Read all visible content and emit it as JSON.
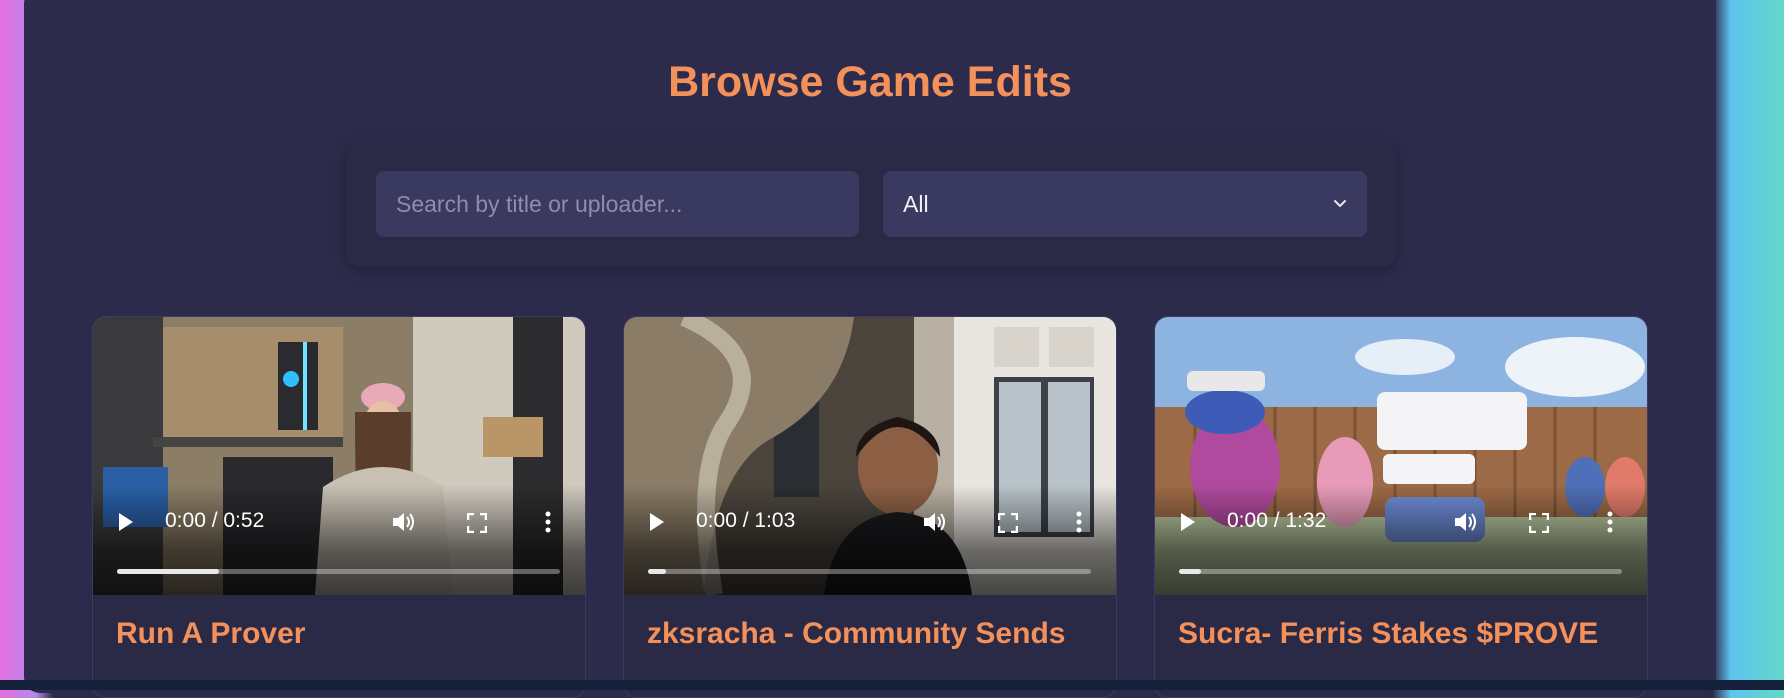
{
  "page": {
    "title": "Browse Game Edits"
  },
  "filters": {
    "search_placeholder": "Search by title or uploader...",
    "search_value": "",
    "category_selected": "All"
  },
  "videos": [
    {
      "title": "Run A Prover",
      "current_time": "0:00",
      "duration": "0:52",
      "time_display": "0:00 / 0:52",
      "progress": 0.23
    },
    {
      "title": "zksracha - Community Sends",
      "current_time": "0:00",
      "duration": "1:03",
      "time_display": "0:00 / 1:03",
      "progress": 0.04
    },
    {
      "title": "Sucra- Ferris Stakes $PROVE",
      "current_time": "0:00",
      "duration": "1:32",
      "time_display": "0:00 / 1:32",
      "progress": 0.05
    }
  ],
  "colors": {
    "accent": "#f4915b",
    "panel": "#2c2b4b",
    "input_bg": "#3a3960"
  }
}
